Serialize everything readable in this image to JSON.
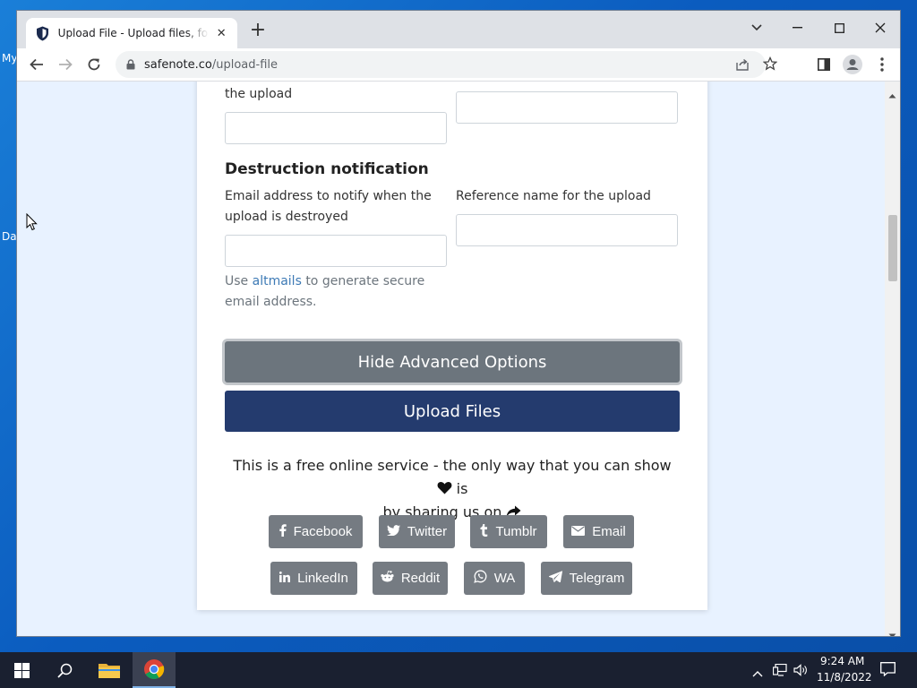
{
  "browser": {
    "tab_title": "Upload File - Upload files, for free",
    "url_host": "safenote.co",
    "url_path": "/upload-file"
  },
  "desktop": {
    "icon_labels": [
      "My",
      "Da"
    ]
  },
  "form": {
    "cut_label": "the upload",
    "destruction_heading": "Destruction notification",
    "email_label": "Email address to notify when the upload is destroyed",
    "email_value": "",
    "reference_label": "Reference name for the upload",
    "reference_value": "",
    "hint_prefix": "Use",
    "hint_link": "altmails",
    "hint_suffix": "to generate secure email address.",
    "hide_advanced_label": "Hide Advanced Options",
    "upload_label": "Upload Files"
  },
  "share": {
    "text_before_heart": "This is a free online service - the only way that you can show",
    "text_after_heart": "is",
    "text_line2": "by sharing us on",
    "buttons_row1": [
      "Facebook",
      "Twitter",
      "Tumblr",
      "Email"
    ],
    "buttons_row2": [
      "LinkedIn",
      "Reddit",
      "WA",
      "Telegram"
    ]
  },
  "taskbar": {
    "time": "9:24 AM",
    "date": "11/8/2022"
  },
  "colors": {
    "navy_button": "#243b6e",
    "grey_button": "#6c757d",
    "share_button": "#757b82",
    "link": "#3d7ab5"
  }
}
